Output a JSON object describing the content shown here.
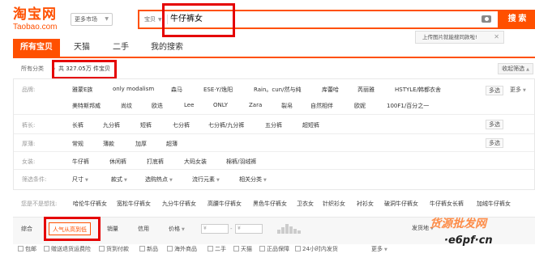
{
  "header": {
    "logo_main": "淘宝网",
    "logo_sub": "Taobao.com",
    "more_market": "更多市场",
    "search_type": "宝贝",
    "search_query": "牛仔裤女",
    "search_button": "搜 索",
    "image_search_tip": "上传图片就能搜同款啦!"
  },
  "tabs": [
    "所有宝贝",
    "天猫",
    "二手",
    "我的搜索"
  ],
  "breadcrumb": {
    "all": "所有分类",
    "sep": "›",
    "count": "共 327.05万 件宝贝",
    "collapse": "收起筛选"
  },
  "filters": {
    "brand": {
      "label": "品牌:",
      "row1": [
        "雅蒙E族",
        "only modalism",
        "森马",
        "ESE·Y/逸阳",
        "Rain。cun/然与纯",
        "库蕾哈",
        "芮丽雅",
        "HSTYLE/韩都衣舍"
      ],
      "row2": [
        "美特斯邦威",
        "尚纹",
        "欧迭",
        "Lee",
        "ONLY",
        "Zara",
        "裂帛",
        "自然相伴",
        "欧妮",
        "100F1/百分之一"
      ],
      "multi": "多选",
      "more": "更多"
    },
    "length": {
      "label": "裤长:",
      "items": [
        "长裤",
        "九分裤",
        "短裤",
        "七分裤",
        "七分裤/九分裤",
        "五分裤",
        "超短裤"
      ],
      "multi": "多选"
    },
    "thickness": {
      "label": "厚薄:",
      "items": [
        "常规",
        "薄款",
        "加厚",
        "超薄"
      ],
      "multi": "多选"
    },
    "womens": {
      "label": "女装:",
      "items": [
        "牛仔裤",
        "休闲裤",
        "打底裤",
        "大码女装",
        "棉裤/羽绒裤"
      ]
    },
    "conditions": {
      "label": "筛选条件:",
      "items": [
        "尺寸",
        "款式",
        "选购热点",
        "流行元素",
        "相关分类"
      ]
    }
  },
  "suggest": {
    "label": "您是不是想找:",
    "items": [
      "哈伦牛仔裤女",
      "宽松牛仔裤女",
      "九分牛仔裤女",
      "高腰牛仔裤女",
      "黑色牛仔裤女",
      "卫衣女",
      "针织衫女",
      "衬衫女",
      "破洞牛仔裤女",
      "牛仔裤女长裤",
      "加绒牛仔裤女"
    ]
  },
  "sort": {
    "items": [
      "综合",
      "人气从高到低",
      "销量",
      "信用",
      "价格"
    ],
    "price_placeholder": "¥",
    "ship_to": "发货地"
  },
  "checkboxes": [
    "包邮",
    "赠送退货运费险",
    "货到付款",
    "新品",
    "海外商品",
    "二手",
    "天猫",
    "正品保障",
    "24小时内发货"
  ],
  "checkbox_more": "更多",
  "watermark": {
    "text": "货源批发网",
    "url": "·e6pf·cn"
  }
}
